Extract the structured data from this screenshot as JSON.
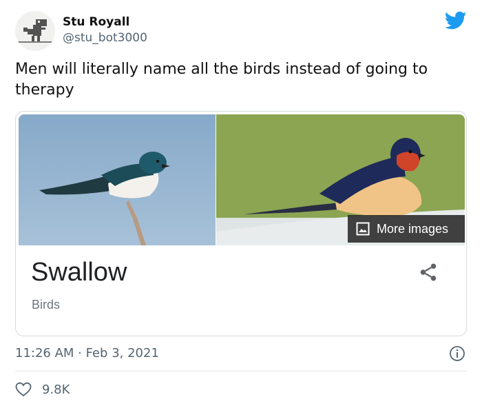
{
  "author": {
    "name": "Stu Royall",
    "handle": "@stu_bot3000"
  },
  "tweet": {
    "text": "Men will literally name all the birds instead of going to therapy",
    "timestamp": "11:26 AM · Feb 3, 2021",
    "likes": "9.8K"
  },
  "card": {
    "title": "Swallow",
    "subtitle": "Birds",
    "more_images_label": "More images"
  },
  "colors": {
    "twitter_blue": "#1d9bf0",
    "text_secondary": "#536471",
    "card_border": "#d6dade"
  },
  "icons": [
    "dino-avatar",
    "twitter-bird-icon",
    "image-icon",
    "share-icon",
    "info-icon",
    "heart-icon"
  ]
}
